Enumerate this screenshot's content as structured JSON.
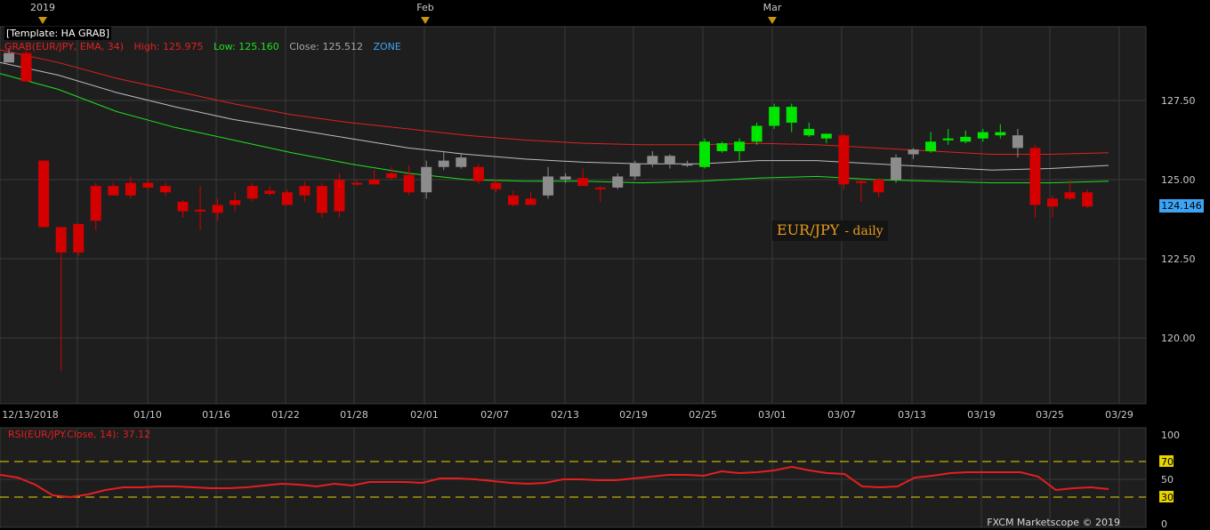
{
  "template_label": "[Template: HA GRAB]",
  "indicator": {
    "name": "GRAB(EUR/JPY, EMA, 34)",
    "high": "High: 125.975",
    "low": "Low: 125.160",
    "close": "Close: 125.512",
    "zone": "ZONE"
  },
  "pair_label": {
    "main": "EUR/JPY",
    "sub": "- daily"
  },
  "rsi_label": "RSI(EUR/JPY.Close, 14): 37.12",
  "last_price": "124.146",
  "copyright": "FXCM Marketscope © 2019",
  "colors": {
    "bull": "#00e600",
    "bear": "#d40000",
    "neutral": "#8c8c8c",
    "grab_high": "#e02020",
    "grab_low": "#20e020",
    "grab_close": "#bdbdbd",
    "rsi": "#e51e1e",
    "rsi_levels": "#e8d400",
    "price_tag": "#3ea3f2",
    "zone": "#3ea3f2"
  },
  "chart_data": [
    {
      "type": "candlestick",
      "title": "EUR/JPY - daily",
      "period_labels": [
        "2019",
        "Feb",
        "Mar"
      ],
      "x_tick_labels": [
        "12/13/2018",
        "01/10",
        "01/16",
        "01/22",
        "01/28",
        "02/01",
        "02/07",
        "02/13",
        "02/19",
        "02/25",
        "03/01",
        "03/07",
        "03/13",
        "03/19",
        "03/25",
        "03/29"
      ],
      "y_tick_labels": [
        "127.50",
        "125.00",
        "122.50",
        "120.00"
      ],
      "ylim": [
        118.0,
        130.5
      ],
      "candles": [
        {
          "o": 129.0,
          "h": 129.15,
          "l": 128.8,
          "c": 128.7,
          "col": "neutral"
        },
        {
          "o": 129.0,
          "h": 129.1,
          "l": 128.2,
          "c": 128.1,
          "col": "bear"
        },
        {
          "o": 125.6,
          "h": 125.6,
          "l": 123.5,
          "c": 123.5,
          "col": "bear"
        },
        {
          "o": 123.5,
          "h": 123.5,
          "l": 118.95,
          "c": 122.7,
          "col": "bear"
        },
        {
          "o": 123.6,
          "h": 123.6,
          "l": 122.6,
          "c": 122.7,
          "col": "bear"
        },
        {
          "o": 123.7,
          "h": 124.9,
          "l": 123.4,
          "c": 124.8,
          "col": "bear"
        },
        {
          "o": 124.8,
          "h": 124.9,
          "l": 124.5,
          "c": 124.5,
          "col": "bear"
        },
        {
          "o": 124.5,
          "h": 125.1,
          "l": 124.4,
          "c": 124.9,
          "col": "bear"
        },
        {
          "o": 124.9,
          "h": 125.0,
          "l": 124.7,
          "c": 124.75,
          "col": "bear"
        },
        {
          "o": 124.8,
          "h": 124.9,
          "l": 124.5,
          "c": 124.6,
          "col": "bear"
        },
        {
          "o": 124.3,
          "h": 124.35,
          "l": 123.8,
          "c": 124.0,
          "col": "bear"
        },
        {
          "o": 124.05,
          "h": 124.8,
          "l": 123.4,
          "c": 124.0,
          "col": "bear"
        },
        {
          "o": 124.2,
          "h": 124.4,
          "l": 123.7,
          "c": 123.95,
          "col": "bear"
        },
        {
          "o": 124.2,
          "h": 124.6,
          "l": 124.0,
          "c": 124.35,
          "col": "bear"
        },
        {
          "o": 124.4,
          "h": 124.9,
          "l": 124.3,
          "c": 124.8,
          "col": "bear"
        },
        {
          "o": 124.65,
          "h": 124.8,
          "l": 124.5,
          "c": 124.55,
          "col": "bear"
        },
        {
          "o": 124.6,
          "h": 124.7,
          "l": 124.2,
          "c": 124.2,
          "col": "bear"
        },
        {
          "o": 124.5,
          "h": 124.95,
          "l": 124.3,
          "c": 124.8,
          "col": "bear"
        },
        {
          "o": 124.8,
          "h": 124.9,
          "l": 123.8,
          "c": 123.95,
          "col": "bear"
        },
        {
          "o": 124.0,
          "h": 125.2,
          "l": 123.8,
          "c": 125.0,
          "col": "bear"
        },
        {
          "o": 124.9,
          "h": 125.0,
          "l": 124.8,
          "c": 124.85,
          "col": "bear"
        },
        {
          "o": 125.0,
          "h": 125.3,
          "l": 124.9,
          "c": 124.85,
          "col": "bear"
        },
        {
          "o": 125.05,
          "h": 125.4,
          "l": 125.0,
          "c": 125.2,
          "col": "bear"
        },
        {
          "o": 125.15,
          "h": 125.45,
          "l": 124.5,
          "c": 124.6,
          "col": "bear"
        },
        {
          "o": 124.6,
          "h": 125.6,
          "l": 124.4,
          "c": 125.4,
          "col": "neutral"
        },
        {
          "o": 125.4,
          "h": 125.9,
          "l": 125.3,
          "c": 125.6,
          "col": "neutral"
        },
        {
          "o": 125.7,
          "h": 125.8,
          "l": 125.35,
          "c": 125.4,
          "col": "neutral"
        },
        {
          "o": 125.4,
          "h": 125.5,
          "l": 124.85,
          "c": 124.95,
          "col": "bear"
        },
        {
          "o": 124.9,
          "h": 125.0,
          "l": 124.6,
          "c": 124.7,
          "col": "bear"
        },
        {
          "o": 124.5,
          "h": 124.65,
          "l": 124.15,
          "c": 124.2,
          "col": "bear"
        },
        {
          "o": 124.4,
          "h": 124.6,
          "l": 124.2,
          "c": 124.2,
          "col": "bear"
        },
        {
          "o": 124.5,
          "h": 125.4,
          "l": 124.4,
          "c": 125.1,
          "col": "neutral"
        },
        {
          "o": 125.0,
          "h": 125.2,
          "l": 124.9,
          "c": 125.1,
          "col": "neutral"
        },
        {
          "o": 125.05,
          "h": 125.35,
          "l": 124.8,
          "c": 124.8,
          "col": "bear"
        },
        {
          "o": 124.75,
          "h": 124.8,
          "l": 124.3,
          "c": 124.7,
          "col": "bear"
        },
        {
          "o": 124.75,
          "h": 125.2,
          "l": 124.7,
          "c": 125.1,
          "col": "neutral"
        },
        {
          "o": 125.1,
          "h": 125.6,
          "l": 125.0,
          "c": 125.5,
          "col": "neutral"
        },
        {
          "o": 125.5,
          "h": 125.9,
          "l": 125.4,
          "c": 125.75,
          "col": "neutral"
        },
        {
          "o": 125.5,
          "h": 125.8,
          "l": 125.35,
          "c": 125.75,
          "col": "neutral"
        },
        {
          "o": 125.5,
          "h": 125.6,
          "l": 125.4,
          "c": 125.5,
          "col": "neutral"
        },
        {
          "o": 125.4,
          "h": 126.3,
          "l": 125.35,
          "c": 126.2,
          "col": "bull"
        },
        {
          "o": 125.9,
          "h": 126.2,
          "l": 125.85,
          "c": 126.15,
          "col": "bull"
        },
        {
          "o": 125.9,
          "h": 126.3,
          "l": 125.6,
          "c": 126.2,
          "col": "bull"
        },
        {
          "o": 126.2,
          "h": 126.8,
          "l": 126.1,
          "c": 126.7,
          "col": "bull"
        },
        {
          "o": 126.7,
          "h": 127.4,
          "l": 126.6,
          "c": 127.3,
          "col": "bull"
        },
        {
          "o": 126.8,
          "h": 127.4,
          "l": 126.5,
          "c": 127.3,
          "col": "bull"
        },
        {
          "o": 126.4,
          "h": 126.8,
          "l": 126.35,
          "c": 126.6,
          "col": "bull"
        },
        {
          "o": 126.3,
          "h": 126.45,
          "l": 126.15,
          "c": 126.45,
          "col": "bull"
        },
        {
          "o": 126.4,
          "h": 126.45,
          "l": 124.7,
          "c": 124.85,
          "col": "bear"
        },
        {
          "o": 124.95,
          "h": 125.0,
          "l": 124.3,
          "c": 124.9,
          "col": "bear"
        },
        {
          "o": 125.0,
          "h": 125.05,
          "l": 124.45,
          "c": 124.6,
          "col": "bear"
        },
        {
          "o": 125.0,
          "h": 125.8,
          "l": 124.9,
          "c": 125.7,
          "col": "neutral"
        },
        {
          "o": 125.8,
          "h": 126.0,
          "l": 125.65,
          "c": 125.95,
          "col": "neutral"
        },
        {
          "o": 125.9,
          "h": 126.5,
          "l": 125.85,
          "c": 126.2,
          "col": "bull"
        },
        {
          "o": 126.25,
          "h": 126.6,
          "l": 126.1,
          "c": 126.3,
          "col": "bull"
        },
        {
          "o": 126.2,
          "h": 126.55,
          "l": 126.15,
          "c": 126.35,
          "col": "bull"
        },
        {
          "o": 126.3,
          "h": 126.6,
          "l": 126.2,
          "c": 126.5,
          "col": "bull"
        },
        {
          "o": 126.4,
          "h": 126.75,
          "l": 126.3,
          "c": 126.5,
          "col": "bull"
        },
        {
          "o": 126.4,
          "h": 126.6,
          "l": 125.7,
          "c": 126.0,
          "col": "neutral"
        },
        {
          "o": 126.0,
          "h": 126.1,
          "l": 123.8,
          "c": 124.2,
          "col": "bear"
        },
        {
          "o": 124.4,
          "h": 124.5,
          "l": 123.8,
          "c": 124.15,
          "col": "bear"
        },
        {
          "o": 124.6,
          "h": 125.0,
          "l": 124.35,
          "c": 124.4,
          "col": "bear"
        },
        {
          "o": 124.6,
          "h": 124.7,
          "l": 124.1,
          "c": 124.15,
          "col": "bear"
        }
      ],
      "grab": {
        "high": [
          129.1,
          128.7,
          128.2,
          127.8,
          127.4,
          127.05,
          126.8,
          126.6,
          126.4,
          126.25,
          126.15,
          126.1,
          126.1,
          126.15,
          126.1,
          126.0,
          125.9,
          125.8,
          125.8,
          125.85
        ],
        "close": [
          128.7,
          128.3,
          127.75,
          127.3,
          126.9,
          126.6,
          126.3,
          126.0,
          125.8,
          125.65,
          125.55,
          125.5,
          125.5,
          125.6,
          125.6,
          125.5,
          125.4,
          125.3,
          125.35,
          125.45
        ],
        "low": [
          128.35,
          127.85,
          127.15,
          126.65,
          126.25,
          125.85,
          125.5,
          125.2,
          125.0,
          124.95,
          124.95,
          124.9,
          124.95,
          125.05,
          125.1,
          125.0,
          124.95,
          124.9,
          124.9,
          124.95
        ]
      }
    },
    {
      "type": "line",
      "title": "RSI(EUR/JPY.Close, 14): 37.12",
      "y_tick_labels": [
        "100",
        "70",
        "50",
        "30",
        "0"
      ],
      "ylim": [
        0,
        100
      ],
      "levels": [
        70,
        50,
        30
      ],
      "values": [
        55,
        52,
        44,
        32,
        30,
        33,
        38,
        41,
        41,
        42,
        42,
        41,
        40,
        40,
        41,
        43,
        45,
        44,
        42,
        45,
        43,
        47,
        47,
        47,
        46,
        51,
        51,
        50,
        48,
        46,
        45,
        46,
        50,
        50,
        49,
        49,
        51,
        53,
        55,
        55,
        54,
        59,
        57,
        58,
        60,
        64,
        60,
        57,
        56,
        42,
        41,
        42,
        52,
        54,
        57,
        58,
        58,
        58,
        58,
        53,
        38,
        40,
        41,
        39
      ]
    }
  ]
}
